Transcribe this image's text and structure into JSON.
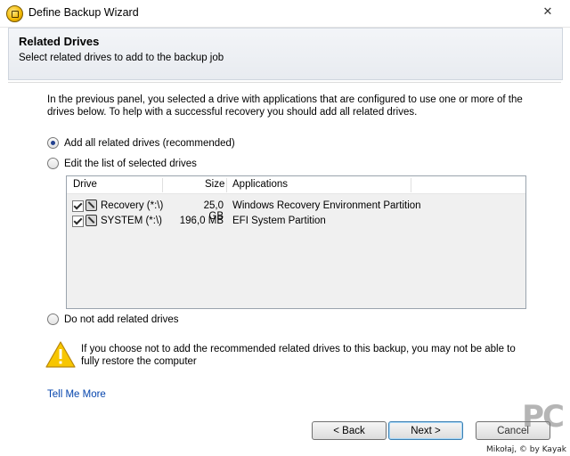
{
  "window": {
    "title": "Define Backup Wizard",
    "close_glyph": "✕"
  },
  "header": {
    "title": "Related Drives",
    "subtitle": "Select related drives to add to the backup job"
  },
  "intro": "In the previous panel, you selected a drive with applications that are configured to use one or more of the drives below. To help with a successful recovery you should add all related drives.",
  "options": {
    "add_all": "Add all related drives (recommended)",
    "edit_list": "Edit the list of selected drives",
    "do_not_add": "Do not add related drives",
    "selected": "add_all"
  },
  "table": {
    "columns": {
      "drive": "Drive",
      "size": "Size",
      "applications": "Applications"
    },
    "rows": [
      {
        "drive": "Recovery (*:\\)",
        "size": "25,0 GB",
        "applications": "Windows Recovery Environment Partition",
        "checked": true
      },
      {
        "drive": "SYSTEM (*:\\)",
        "size": "196,0 MB",
        "applications": "EFI System Partition",
        "checked": true
      }
    ]
  },
  "warning": "If you choose not to add the recommended related drives to this backup, you may not be able to fully restore the computer",
  "link": "Tell Me More",
  "buttons": {
    "back": "< Back",
    "next": "Next >",
    "cancel": "Cancel"
  },
  "watermark": {
    "brand": "PC",
    "credit": "Mikołaj, © by Kayak"
  },
  "colors": {
    "accent": "#23418f",
    "link": "#0645ad",
    "warning": "#f5c400"
  }
}
